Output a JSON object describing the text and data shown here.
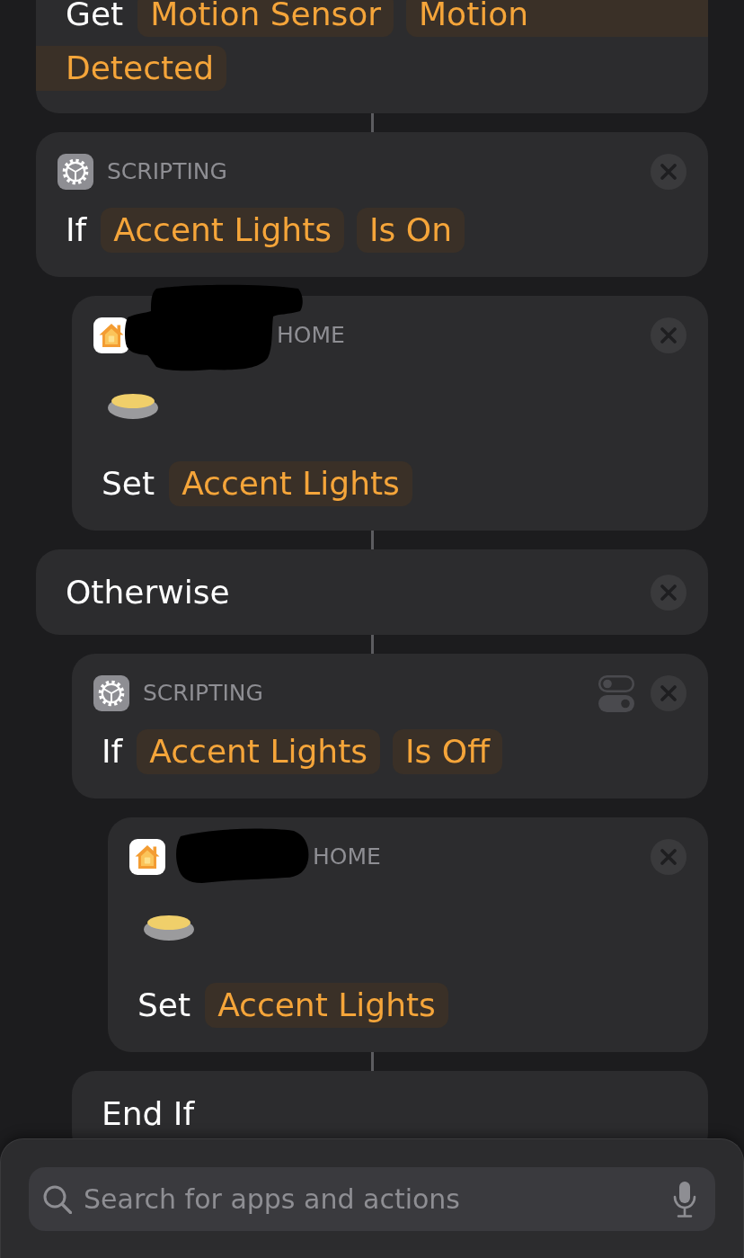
{
  "flow": [
    {
      "kind": "get",
      "removable": false,
      "connected": true,
      "sentence": [
        {
          "kind": "word",
          "text": "Get"
        },
        {
          "kind": "token",
          "text": "Motion Sensor"
        },
        {
          "kind": "wrapped_token",
          "lines": [
            "Motion",
            "Detected"
          ]
        }
      ]
    },
    {
      "kind": "if",
      "app_label": "SCRIPTING",
      "toggle": false,
      "removable": true,
      "connected": false,
      "sentence": [
        {
          "kind": "word",
          "text": "If"
        },
        {
          "kind": "token",
          "text": "Accent Lights"
        },
        {
          "kind": "token",
          "text": "Is On"
        }
      ],
      "children": [
        {
          "kind": "home_set",
          "app_label": "HOME",
          "redacted": true,
          "removable": true,
          "connected": true,
          "sentence": [
            {
              "kind": "word",
              "text": "Set"
            },
            {
              "kind": "token",
              "text": "Accent Lights"
            }
          ]
        }
      ]
    },
    {
      "kind": "otherwise",
      "title": "Otherwise",
      "removable": true,
      "connected": true,
      "children": [
        {
          "kind": "if",
          "app_label": "SCRIPTING",
          "toggle": true,
          "removable": true,
          "connected": false,
          "sentence": [
            {
              "kind": "word",
              "text": "If"
            },
            {
              "kind": "token",
              "text": "Accent Lights"
            },
            {
              "kind": "token",
              "text": "Is Off"
            }
          ],
          "children": [
            {
              "kind": "home_set",
              "app_label": "HOME",
              "redacted": true,
              "removable": true,
              "connected": true,
              "sentence": [
                {
                  "kind": "word",
                  "text": "Set"
                },
                {
                  "kind": "token",
                  "text": "Accent Lights"
                }
              ]
            }
          ]
        },
        {
          "kind": "end_if",
          "title": "End If",
          "removable": false,
          "connected": false
        }
      ]
    }
  ],
  "search": {
    "placeholder": "Search for apps and actions"
  }
}
